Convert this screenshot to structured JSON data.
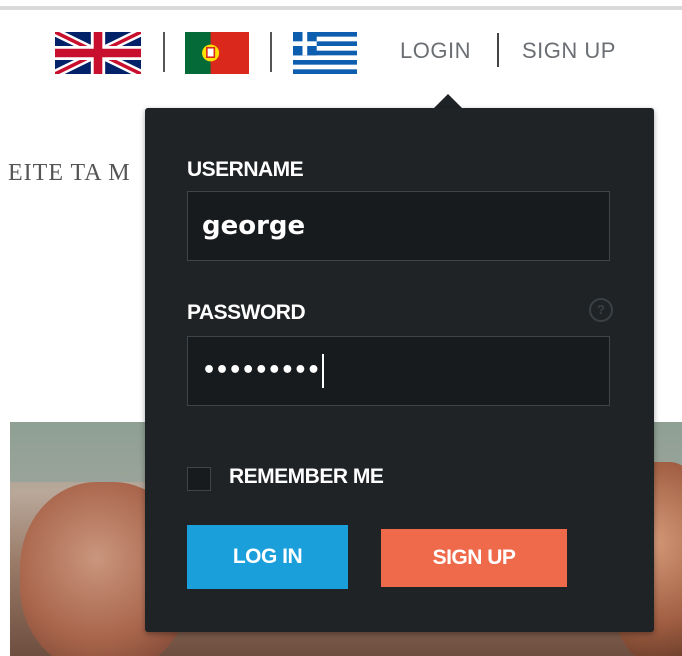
{
  "header": {
    "languages": [
      {
        "icon": "uk-flag-icon"
      },
      {
        "icon": "portugal-flag-icon"
      },
      {
        "icon": "greece-flag-icon"
      }
    ],
    "login_link": "LOGIN",
    "signup_link": "SIGN UP"
  },
  "background": {
    "partial_heading": "EITE TA M"
  },
  "login_dropdown": {
    "username_label": "USERNAME",
    "username_value": "george",
    "password_label": "PASSWORD",
    "password_value": "•••••••••",
    "help_icon": "?",
    "remember_label": "REMEMBER ME",
    "remember_checked": false,
    "login_button": "LOG IN",
    "signup_button": "SIGN UP"
  },
  "colors": {
    "dropdown_bg": "#1f2326",
    "login_button": "#1a9fdb",
    "signup_button": "#ee6a4a"
  }
}
